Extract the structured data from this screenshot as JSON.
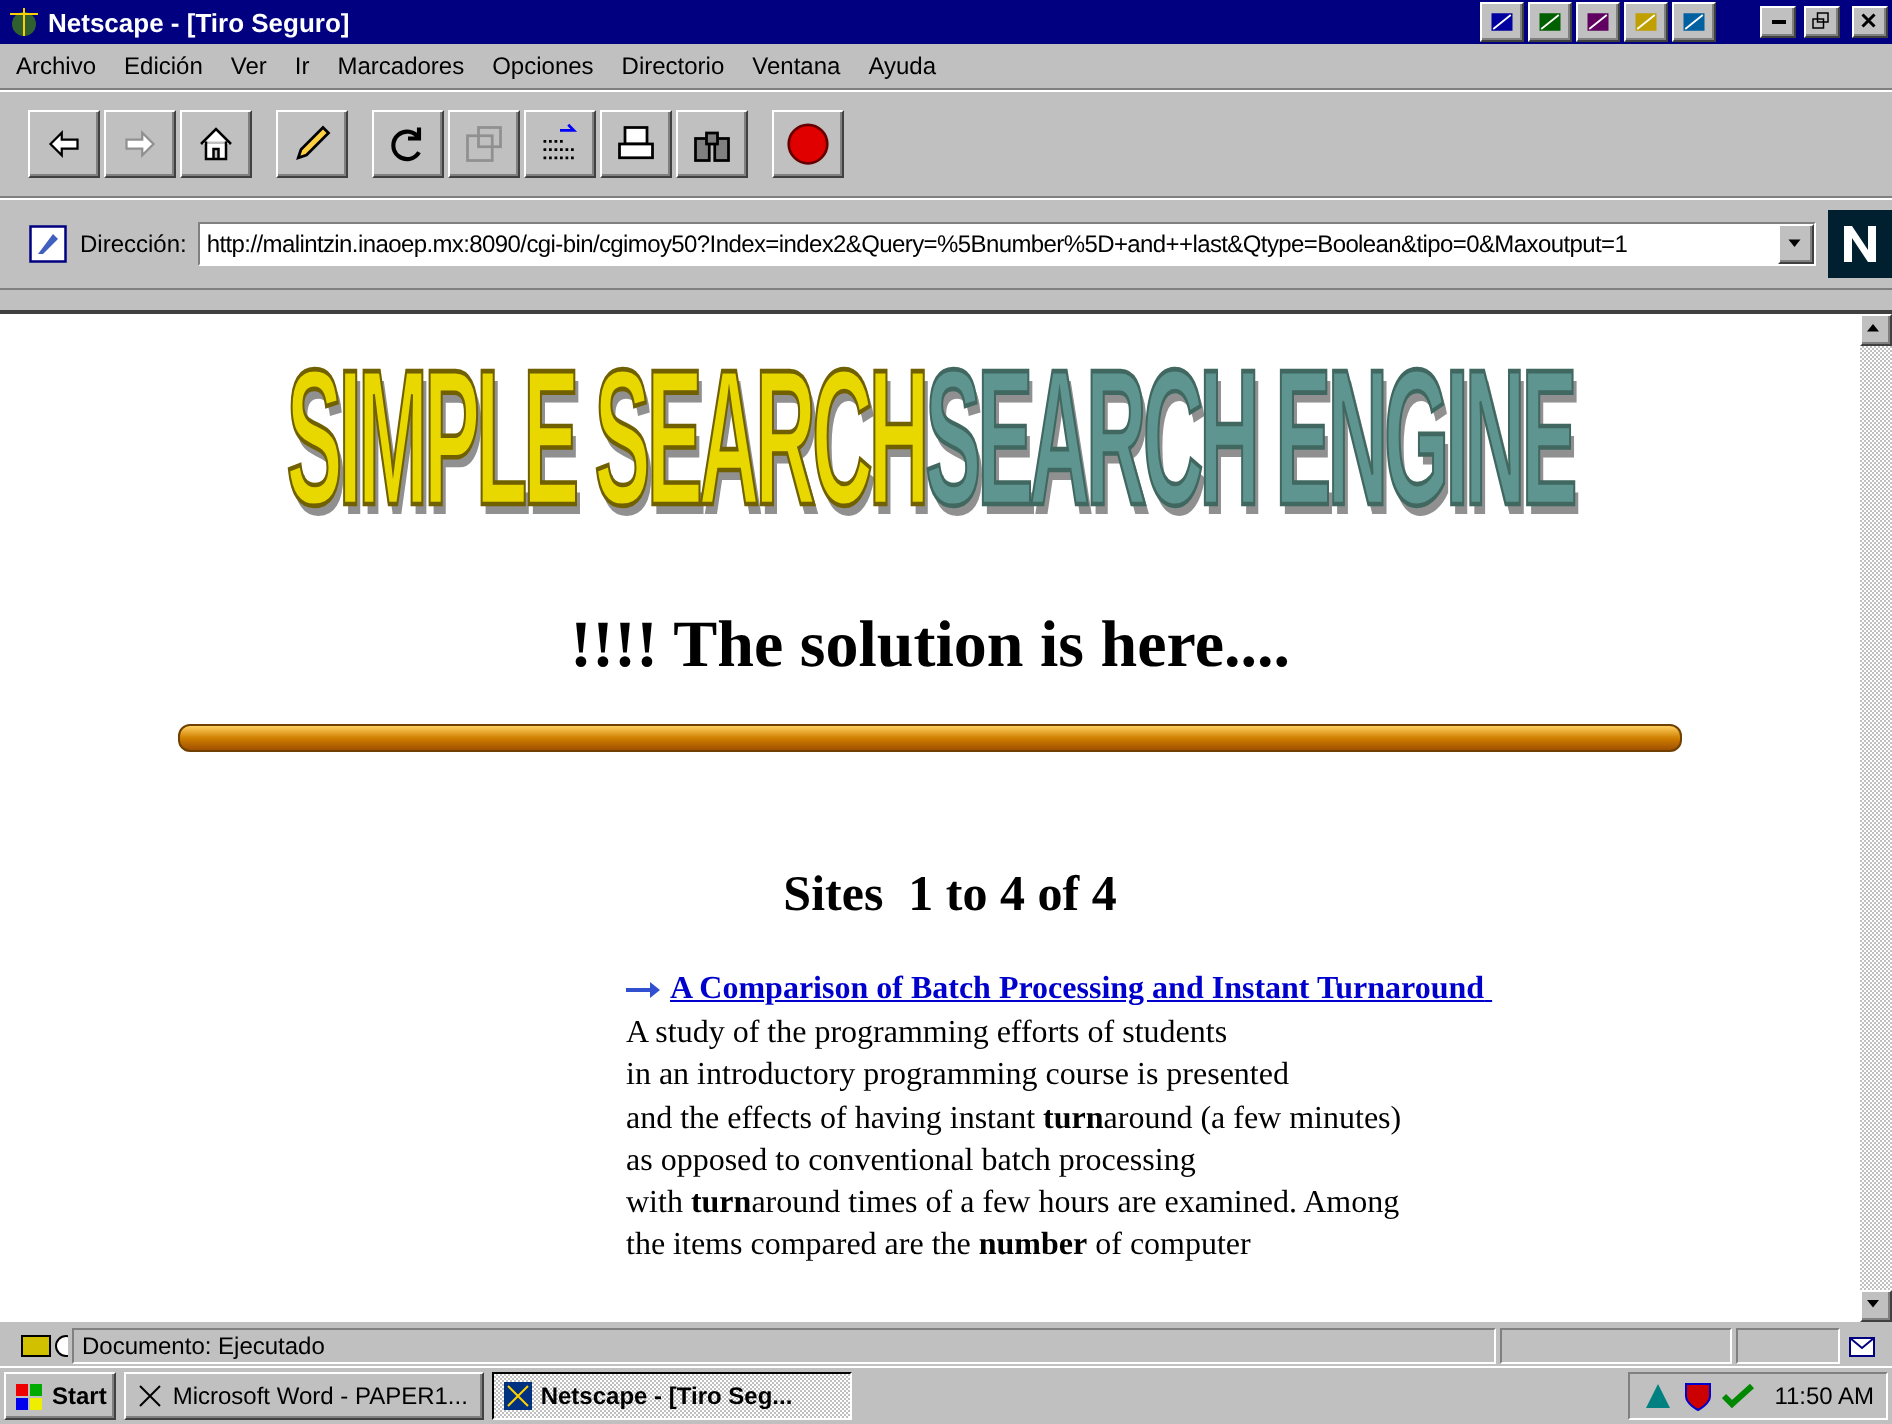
{
  "window": {
    "title": "Netscape - [Tiro Seguro]"
  },
  "menu": [
    "Archivo",
    "Edición",
    "Ver",
    "Ir",
    "Marcadores",
    "Opciones",
    "Directorio",
    "Ventana",
    "Ayuda"
  ],
  "toolbar": {
    "groups": [
      [
        {
          "kind": "back",
          "disabled": false
        },
        {
          "kind": "forward",
          "disabled": true
        },
        {
          "kind": "home",
          "disabled": false
        }
      ],
      [
        {
          "kind": "edit",
          "disabled": false
        }
      ],
      [
        {
          "kind": "reload",
          "disabled": false
        },
        {
          "kind": "images",
          "disabled": true
        },
        {
          "kind": "open",
          "disabled": false
        },
        {
          "kind": "print",
          "disabled": false
        },
        {
          "kind": "find",
          "disabled": false
        }
      ],
      [
        {
          "kind": "stop",
          "disabled": false
        }
      ]
    ]
  },
  "address": {
    "label": "Dirección:",
    "value": "http://malintzin.inaoep.mx:8090/cgi-bin/cgimoy50?Index=index2&Query=%5Bnumber%5D+and++last&Qtype=Boolean&tipo=0&Maxoutput=1"
  },
  "page": {
    "logo": [
      "SIMPLE SEARCH",
      "SEARCH ENGINE"
    ],
    "heading": "!!!! The solution is here....",
    "sites": "Sites  1 to 4 of 4",
    "result": {
      "title": "A Comparison of Batch Processing and Instant Turnaround",
      "lines": [
        "A study of the programming efforts of students",
        "in an introductory programming course is presented",
        "and the effects of having instant **turn**around (a few minutes)",
        "as opposed to conventional batch processing",
        "with **turn**around times of a few hours are examined. Among",
        "the items compared are the **number** of computer"
      ]
    }
  },
  "status_bar": {
    "text": "Documento: Ejecutado"
  },
  "taskbar": {
    "start": "Start",
    "tasks": [
      {
        "label": "Microsoft Word - PAPER1...",
        "selected": false
      },
      {
        "label": "Netscape - [Tiro Seg...",
        "selected": true
      }
    ],
    "clock": "11:50 AM"
  }
}
